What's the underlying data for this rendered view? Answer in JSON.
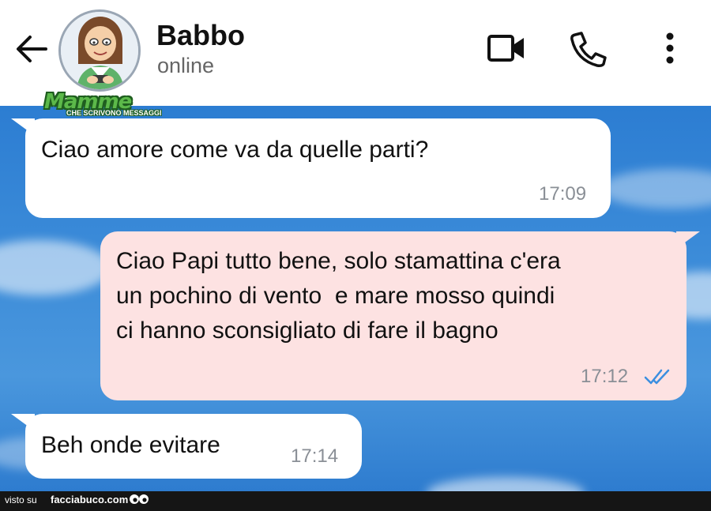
{
  "header": {
    "contact_name": "Babbo",
    "status": "online",
    "logo_text": "Mamme",
    "logo_subtext": "CHE SCRIVONO MESSAGGI",
    "icons": [
      "back-arrow-icon",
      "video-call-icon",
      "phone-icon",
      "more-options-icon"
    ]
  },
  "messages": [
    {
      "direction": "incoming",
      "lines": [
        "Ciao amore come va da quelle parti?"
      ],
      "time": "17:09"
    },
    {
      "direction": "outgoing",
      "lines": [
        "Ciao Papi tutto bene, solo stamattina c'era",
        "un pochino di vento  e mare mosso quindi",
        "ci hanno sconsigliato di fare il bagno"
      ],
      "time": "17:12",
      "read_receipt": "double-check-icon"
    },
    {
      "direction": "incoming",
      "lines": [
        "Beh onde evitare"
      ],
      "time": "17:14"
    }
  ],
  "footer": {
    "prefix": "visto su",
    "site": "facciabuco.com"
  },
  "colors": {
    "incoming_bubble": "#ffffff",
    "outgoing_bubble": "#fde2e2",
    "read_tick": "#3b8fe0",
    "background": "#2f7fd1"
  }
}
